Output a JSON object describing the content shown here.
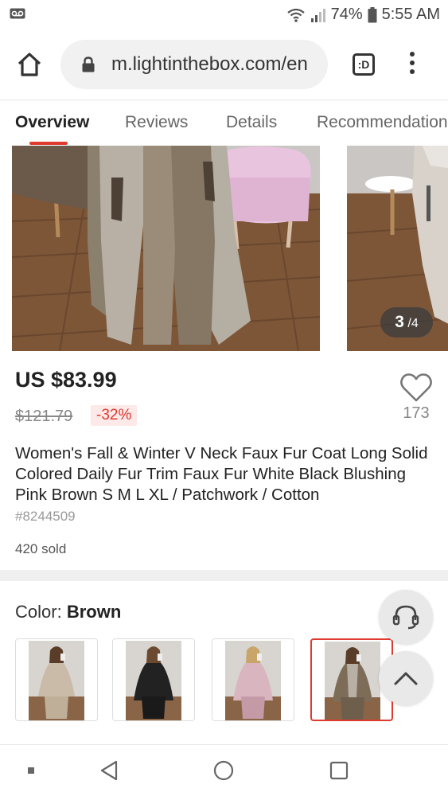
{
  "status_bar": {
    "battery": "74%",
    "time": "5:55 AM",
    "icons": [
      "voicemail-icon",
      "wifi-icon",
      "signal-icon",
      "battery-icon"
    ]
  },
  "browser": {
    "url": "m.lightinthebox.com/en",
    "tab_switcher_label": ":D",
    "icons": [
      "home-icon",
      "lock-icon",
      "tab-switcher-icon",
      "more-menu-icon"
    ]
  },
  "product_tabs": [
    {
      "label": "Overview",
      "active": true
    },
    {
      "label": "Reviews",
      "active": false
    },
    {
      "label": "Details",
      "active": false
    },
    {
      "label": "Recommendations",
      "active": false
    }
  ],
  "gallery": {
    "current": "3",
    "total": "/4"
  },
  "product": {
    "price": "US $83.99",
    "original_price": "$121.79",
    "discount": "-32%",
    "likes": "173",
    "title": "Women's Fall & Winter V Neck Faux Fur Coat Long Solid Colored Daily Fur Trim Faux Fur White Black Blushing Pink Brown S M L XL / Patchwork / Cotton",
    "sku": "#8244509",
    "sold": "420 sold"
  },
  "color": {
    "label": "Color:",
    "value": "Brown",
    "swatches": [
      "beige",
      "black",
      "pink",
      "brown"
    ],
    "selected_index": 3
  },
  "colors": {
    "accent": "#e03a2f",
    "discount_bg": "#fde9e8"
  },
  "nav_icons": [
    "recent-apps-dot-icon",
    "back-icon",
    "home-circle-icon",
    "overview-square-icon"
  ]
}
